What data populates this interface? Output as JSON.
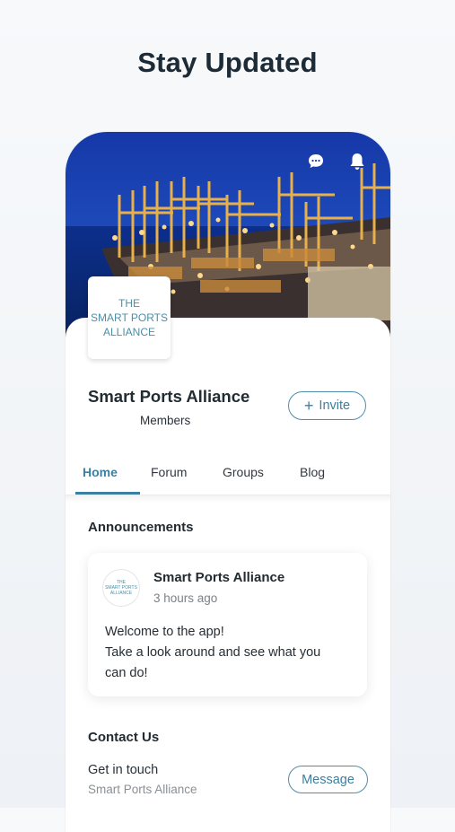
{
  "headline": "Stay Updated",
  "group": {
    "logo_lines": [
      "THE",
      "SMART PORTS",
      "ALLIANCE"
    ],
    "name": "Smart Ports Alliance",
    "members_label": "Members",
    "invite_label": "Invite",
    "invite_icon": "plus-icon"
  },
  "header_icons": [
    "chat-icon",
    "bell-icon"
  ],
  "tabs": [
    {
      "label": "Home",
      "active": true
    },
    {
      "label": "Forum",
      "active": false
    },
    {
      "label": "Groups",
      "active": false
    },
    {
      "label": "Blog",
      "active": false
    }
  ],
  "announcements": {
    "title": "Announcements",
    "post": {
      "avatar_lines": [
        "THE",
        "SMART PORTS",
        "ALLIANCE"
      ],
      "author": "Smart Ports Alliance",
      "time": "3 hours ago",
      "body_lines": [
        "Welcome to the app!",
        "Take a look around and see what you",
        "can do!"
      ]
    }
  },
  "contact": {
    "title": "Contact Us",
    "line1": "Get in touch",
    "line2": "Smart Ports Alliance",
    "button_label": "Message"
  },
  "colors": {
    "accent": "#3d7fa0",
    "headline": "#1d2b36"
  }
}
